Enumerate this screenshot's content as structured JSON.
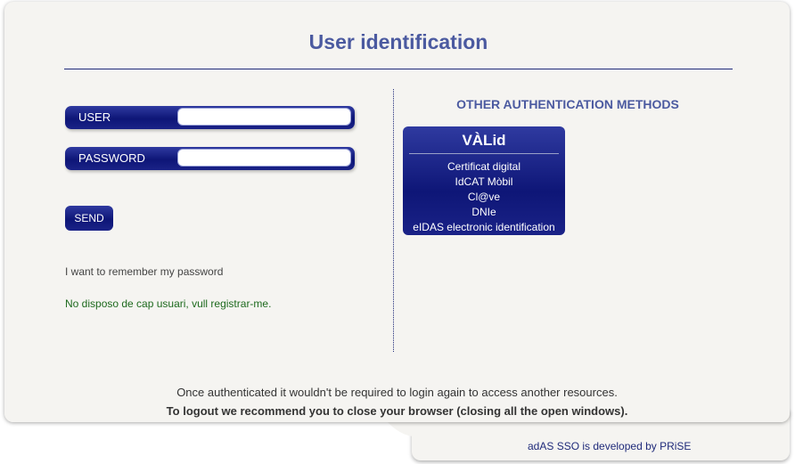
{
  "header": {
    "title": "User identification"
  },
  "login_form": {
    "user_label": "USER",
    "user_value": "",
    "password_label": "PASSWORD",
    "password_value": "",
    "send_label": "SEND",
    "remember_text": "I want to remember my password",
    "register_link": "No disposo de cap usuari, vull registrar-me."
  },
  "other_methods": {
    "title": "OTHER AUTHENTICATION METHODS",
    "valid": {
      "title": "VÀLid",
      "items": [
        "Certificat digital",
        "IdCAT Mòbil",
        "Cl@ve",
        "DNIe",
        "eIDAS electronic identification"
      ]
    }
  },
  "footer": {
    "notice": "Once authenticated it wouldn't be required to login again to access another resources.",
    "logout_advice": "To logout we recommend you to close your browser (closing all the open windows).",
    "developed_by": "adAS SSO is developed by PRiSE"
  },
  "colors": {
    "accent": "#4b5aa0",
    "button": "#0e1677",
    "link_green": "#1e6a1e",
    "background": "#f5f4f1"
  }
}
